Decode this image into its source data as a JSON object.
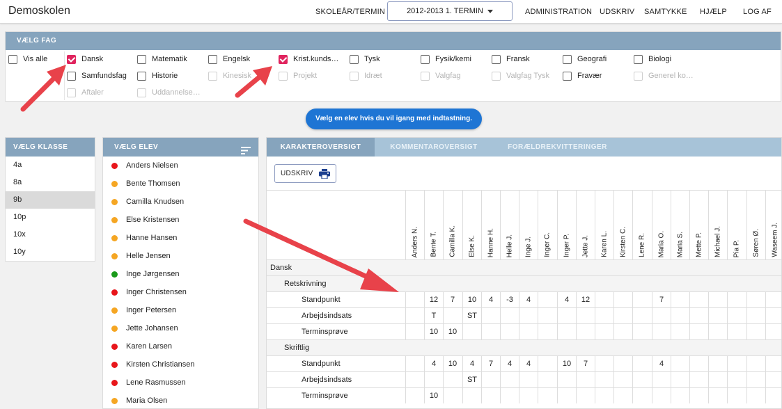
{
  "app": {
    "title": "Demoskolen"
  },
  "topbar": {
    "term_label": "SKOLEÅR/TERMIN",
    "term_value": "2012-2013 1. TERMIN",
    "nav": [
      "ADMINISTRATION",
      "UDSKRIV",
      "SAMTYKKE",
      "HJÆLP",
      "LOG AF"
    ]
  },
  "fag": {
    "header": "VÆLG FAG",
    "vis_alle": "Vis alle",
    "subjects": [
      {
        "label": "Dansk",
        "checked": true,
        "disabled": false
      },
      {
        "label": "Matematik",
        "checked": false,
        "disabled": false
      },
      {
        "label": "Engelsk",
        "checked": false,
        "disabled": false
      },
      {
        "label": "Krist.kunds…",
        "checked": true,
        "disabled": false
      },
      {
        "label": "Tysk",
        "checked": false,
        "disabled": false
      },
      {
        "label": "Fysik/kemi",
        "checked": false,
        "disabled": false
      },
      {
        "label": "Fransk",
        "checked": false,
        "disabled": false
      },
      {
        "label": "Geografi",
        "checked": false,
        "disabled": false
      },
      {
        "label": "Biologi",
        "checked": false,
        "disabled": false
      },
      {
        "label": "Samfundsfag",
        "checked": false,
        "disabled": false
      },
      {
        "label": "Historie",
        "checked": false,
        "disabled": false
      },
      {
        "label": "Kinesisk",
        "checked": false,
        "disabled": true
      },
      {
        "label": "Projekt",
        "checked": false,
        "disabled": true
      },
      {
        "label": "Idræt",
        "checked": false,
        "disabled": true
      },
      {
        "label": "Valgfag",
        "checked": false,
        "disabled": true
      },
      {
        "label": "Valgfag Tysk",
        "checked": false,
        "disabled": true
      },
      {
        "label": "Fravær",
        "checked": false,
        "disabled": false
      },
      {
        "label": "Generel ko…",
        "checked": false,
        "disabled": true
      },
      {
        "label": "Aftaler",
        "checked": false,
        "disabled": true
      },
      {
        "label": "Uddannelse…",
        "checked": false,
        "disabled": true
      }
    ]
  },
  "hint": "Vælg en elev hvis du vil igang med indtastning.",
  "klasse": {
    "header": "VÆLG KLASSE",
    "items": [
      "4a",
      "8a",
      "9b",
      "10p",
      "10x",
      "10y"
    ],
    "selected": "9b"
  },
  "elev": {
    "header": "VÆLG ELEV",
    "status_colors": {
      "red": "#e8161b",
      "orange": "#f5a623",
      "green": "#1a9a1a"
    },
    "students": [
      {
        "name": "Anders Nielsen",
        "status": "red"
      },
      {
        "name": "Bente Thomsen",
        "status": "orange"
      },
      {
        "name": "Camilla Knudsen",
        "status": "orange"
      },
      {
        "name": "Else Kristensen",
        "status": "orange"
      },
      {
        "name": "Hanne Hansen",
        "status": "orange"
      },
      {
        "name": "Helle Jensen",
        "status": "orange"
      },
      {
        "name": "Inge Jørgensen",
        "status": "green"
      },
      {
        "name": "Inger Christensen",
        "status": "red"
      },
      {
        "name": "Inger Petersen",
        "status": "orange"
      },
      {
        "name": "Jette Johansen",
        "status": "orange"
      },
      {
        "name": "Karen Larsen",
        "status": "red"
      },
      {
        "name": "Kirsten Christiansen",
        "status": "red"
      },
      {
        "name": "Lene Rasmussen",
        "status": "red"
      },
      {
        "name": "Maria Olsen",
        "status": "orange"
      }
    ]
  },
  "grades": {
    "tabs": [
      "KARAKTEROVERSIGT",
      "KOMMENTAROVERSIGT",
      "FORÆLDREKVITTERINGER"
    ],
    "print_label": "UDSKRIV",
    "columns": [
      "Anders N.",
      "Bente T.",
      "Camilla K.",
      "Else K.",
      "Hanne H.",
      "Helle J.",
      "Inge J.",
      "Inger C.",
      "Inger P.",
      "Jette J.",
      "Karen L.",
      "Kirsten C.",
      "Lene R.",
      "Maria O.",
      "Maria S.",
      "Mette P.",
      "Michael J.",
      "Pia P.",
      "Søren Ø.",
      "Waseem J."
    ],
    "rows": [
      {
        "type": "subject",
        "label": "Dansk"
      },
      {
        "type": "section",
        "label": "Retskrivning"
      },
      {
        "type": "data",
        "label": "Standpunkt",
        "values": [
          "",
          "12",
          "7",
          "10",
          "4",
          "-3",
          "4",
          "",
          "4",
          "12",
          "",
          "",
          "",
          "7",
          "",
          "",
          "",
          "",
          "",
          ""
        ]
      },
      {
        "type": "data",
        "label": "Arbejdsindsats",
        "values": [
          "",
          "T",
          "",
          "ST",
          "",
          "",
          "",
          "",
          "",
          "",
          "",
          "",
          "",
          "",
          "",
          "",
          "",
          "",
          "",
          ""
        ]
      },
      {
        "type": "data",
        "label": "Terminsprøve",
        "values": [
          "",
          "10",
          "10",
          "",
          "",
          "",
          "",
          "",
          "",
          "",
          "",
          "",
          "",
          "",
          "",
          "",
          "",
          "",
          "",
          ""
        ]
      },
      {
        "type": "section",
        "label": "Skriftlig"
      },
      {
        "type": "data",
        "label": "Standpunkt",
        "values": [
          "",
          "4",
          "10",
          "4",
          "7",
          "4",
          "4",
          "",
          "10",
          "7",
          "",
          "",
          "",
          "4",
          "",
          "",
          "",
          "",
          "",
          ""
        ]
      },
      {
        "type": "data",
        "label": "Arbejdsindsats",
        "values": [
          "",
          "",
          "",
          "ST",
          "",
          "",
          "",
          "",
          "",
          "",
          "",
          "",
          "",
          "",
          "",
          "",
          "",
          "",
          "",
          ""
        ]
      },
      {
        "type": "data",
        "label": "Terminsprøve",
        "values": [
          "",
          "10",
          "",
          "",
          "",
          "",
          "",
          "",
          "",
          "",
          "",
          "",
          "",
          "",
          "",
          "",
          "",
          "",
          "",
          ""
        ]
      }
    ]
  }
}
